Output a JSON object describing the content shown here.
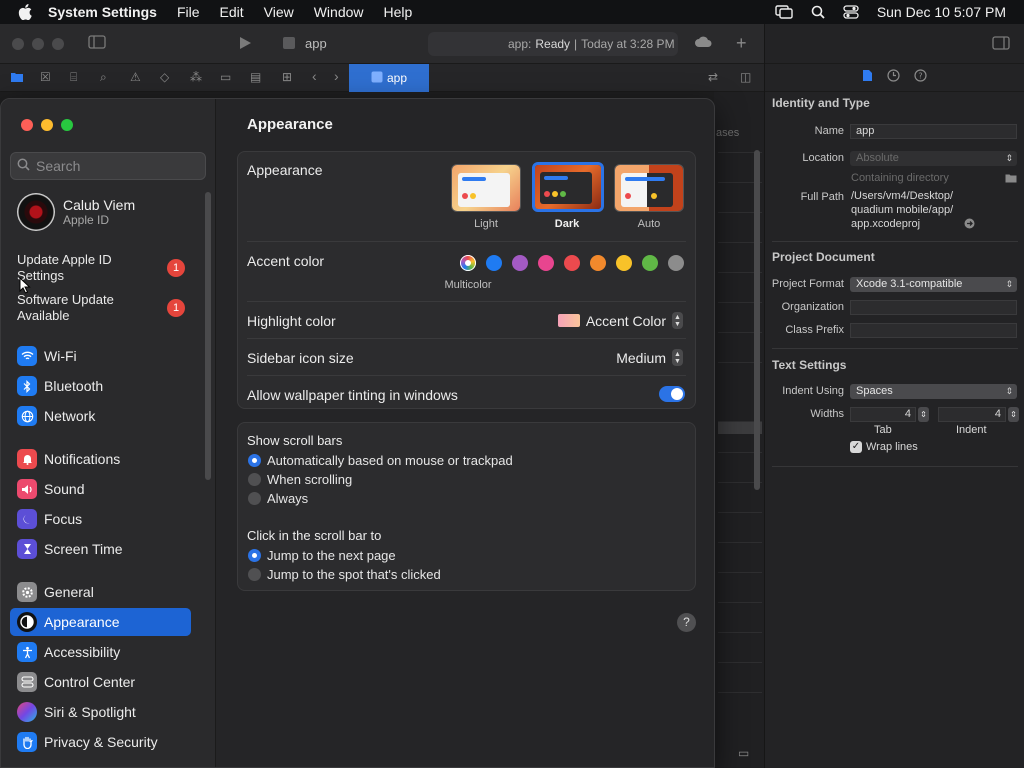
{
  "menubar": {
    "app_name": "System Settings",
    "items": [
      "File",
      "Edit",
      "View",
      "Window",
      "Help"
    ],
    "datetime": "Sun Dec 10  5:07 PM"
  },
  "xcode": {
    "title": "app",
    "status_scheme": "app:",
    "status_state": "Ready",
    "status_time": "Today at 3:28 PM",
    "tab_label": "app",
    "cases_label": "ases"
  },
  "inspector": {
    "identity_title": "Identity and Type",
    "name_label": "Name",
    "name_value": "app",
    "location_label": "Location",
    "location_value": "Absolute",
    "containing_dir": "Containing directory",
    "fullpath_label": "Full Path",
    "fullpath_value_1": "/Users/vm4/Desktop/",
    "fullpath_value_2": "quadium mobile/app/",
    "fullpath_value_3": "app.xcodeproj",
    "project_doc_title": "Project Document",
    "project_format_label": "Project Format",
    "project_format_value": "Xcode 3.1-compatible",
    "organization_label": "Organization",
    "class_prefix_label": "Class Prefix",
    "text_settings_title": "Text Settings",
    "indent_using_label": "Indent Using",
    "indent_using_value": "Spaces",
    "widths_label": "Widths",
    "tab_value": "4",
    "indent_value": "4",
    "tab_label": "Tab",
    "indent_label": "Indent",
    "wrap_lines_label": "Wrap lines"
  },
  "settings": {
    "search_placeholder": "Search",
    "user_name": "Calub Viem",
    "user_sub": "Apple ID",
    "notice_1": "Update Apple ID Settings",
    "notice_1_badge": "1",
    "notice_2": "Software Update Available",
    "notice_2_badge": "1",
    "sidebar": {
      "wifi": "Wi-Fi",
      "bluetooth": "Bluetooth",
      "network": "Network",
      "notifications": "Notifications",
      "sound": "Sound",
      "focus": "Focus",
      "screen_time": "Screen Time",
      "general": "General",
      "appearance": "Appearance",
      "accessibility": "Accessibility",
      "control_center": "Control Center",
      "siri": "Siri & Spotlight",
      "privacy": "Privacy & Security"
    },
    "title": "Appearance",
    "appearance_label": "Appearance",
    "modes": {
      "light": "Light",
      "dark": "Dark",
      "auto": "Auto"
    },
    "selected_mode": "Dark",
    "accent_label": "Accent color",
    "accent_selected": "Multicolor",
    "accent_colors": [
      "#1f7bf2",
      "#a35ac4",
      "#e8458f",
      "#ec4a4e",
      "#f2892c",
      "#f8c229",
      "#60b846",
      "#8c8c8c"
    ],
    "highlight_label": "Highlight color",
    "highlight_value": "Accent Color",
    "sidebar_icon_label": "Sidebar icon size",
    "sidebar_icon_value": "Medium",
    "wallpaper_tint_label": "Allow wallpaper tinting in windows",
    "wallpaper_tint_on": true,
    "scrollbars_label": "Show scroll bars",
    "scroll_opt_1": "Automatically based on mouse or trackpad",
    "scroll_opt_2": "When scrolling",
    "scroll_opt_3": "Always",
    "click_label": "Click in the scroll bar to",
    "click_opt_1": "Jump to the next page",
    "click_opt_2": "Jump to the spot that's clicked",
    "help": "?"
  }
}
